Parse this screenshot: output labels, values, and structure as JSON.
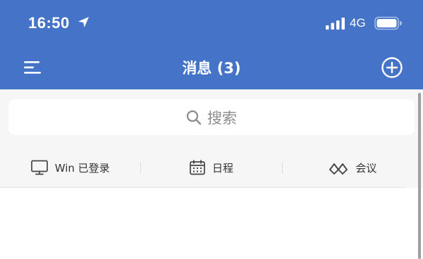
{
  "status_bar": {
    "time": "16:50",
    "network": "4G"
  },
  "header": {
    "title": "消息 (3)",
    "background": "#4573C8"
  },
  "search": {
    "placeholder": "搜索"
  },
  "toolbar": {
    "items": [
      {
        "label": "Win 已登录",
        "icon": "monitor-icon"
      },
      {
        "label": "日程",
        "icon": "calendar-icon"
      },
      {
        "label": "会议",
        "icon": "meeting-icon"
      }
    ]
  }
}
